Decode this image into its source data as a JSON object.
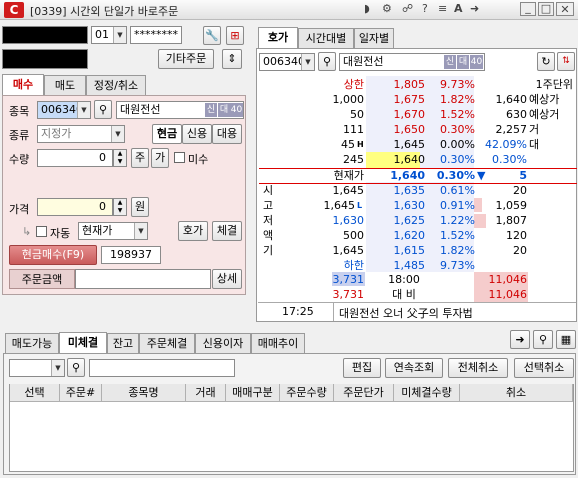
{
  "window": {
    "logo": "C",
    "title": "[0339] 시간외 단일가 바로주문",
    "tb_icons": [
      "headset-icon",
      "gear-icon",
      "link-icon",
      "help-icon",
      "menu-icon",
      "font-icon",
      "sticky-icon",
      "minimize-icon",
      "restore-icon",
      "close-icon"
    ]
  },
  "account": {
    "number": "",
    "suffix": "01",
    "password": "********",
    "name": ""
  },
  "other_order_label": "기타주문",
  "order_tabs": [
    "매수",
    "매도",
    "정정/취소"
  ],
  "order_form": {
    "code_label": "종목",
    "code": "006340",
    "stock_name": "대원전선",
    "badge_credit": "신",
    "badge_rate": "대",
    "badge_margin": "40",
    "type_label": "종류",
    "type_value": "지정가",
    "cash_label": "현금",
    "credit_label": "신용",
    "loan_label": "대용",
    "qty_label": "수량",
    "qty_value": "0",
    "qty_unit": "주",
    "price_short": "가",
    "unfilled_label": "미수",
    "price_label": "가격",
    "price_value": "0",
    "price_unit": "원",
    "auto_label": "자동",
    "auto_mode": "현재가",
    "quote_btn": "호가",
    "fill_btn": "체결",
    "buy_btn": "현금매수(F9)",
    "buy_max": "198937",
    "amount_label": "주문금액",
    "detail_btn": "상세"
  },
  "quote_tabs": [
    "호가",
    "시간대별",
    "일자별"
  ],
  "quote": {
    "code": "006340",
    "stock_name": "대원전선",
    "badge_credit": "신",
    "badge_rate": "대",
    "badge_margin": "40",
    "upper_label": "상한",
    "upper_price": "1,805",
    "upper_pct": "9.73%",
    "unit": "1주단위",
    "ask_rows": [
      {
        "qty": "1,000",
        "price": "1,675",
        "pct": "1.82%",
        "r": "1,640",
        "rl": "예상가"
      },
      {
        "qty": "50",
        "price": "1,670",
        "pct": "1.52%",
        "r": "630",
        "rl": "예상거"
      },
      {
        "qty": "111",
        "price": "1,650",
        "pct": "0.30%",
        "r": "2,257",
        "rl": "거"
      },
      {
        "qty": "45",
        "price": "1,645",
        "pct": "0.00%",
        "r": "42.09%",
        "rl": "대",
        "mark": "H"
      },
      {
        "qty": "245",
        "price": "1,640",
        "pct": "0.30%",
        "r": "0.30%",
        "rl": ""
      }
    ],
    "cur_label": "현재가",
    "cur_price": "1,640",
    "cur_pct": "0.30%",
    "cur_arrow": "▼",
    "cur_change": "5",
    "bid_rows": [
      {
        "label": "시",
        "lv": "1,645",
        "price": "1,635",
        "pct": "0.61%",
        "r": "20"
      },
      {
        "label": "고",
        "lv": "1,645",
        "price": "1,630",
        "pct": "0.91%",
        "r": "1,059",
        "mark": "L"
      },
      {
        "label": "저",
        "lv": "1,630",
        "price": "1,625",
        "pct": "1.22%",
        "r": "1,807"
      },
      {
        "label": "액",
        "lv": "500",
        "price": "1,620",
        "pct": "1.52%",
        "r": "120"
      },
      {
        "label": "기",
        "lv": "1,645",
        "price": "1,615",
        "pct": "1.82%",
        "r": "20"
      }
    ],
    "lower_label": "하한",
    "lower_price": "1,485",
    "lower_pct": "9.73%",
    "total_ask": "3,731",
    "time_close": "18:00",
    "total_bid": "11,046",
    "total_ask2": "3,731",
    "diff_label": "대 비",
    "total_bid2": "11,046",
    "news_time": "17:25",
    "news_text": "대원전선 오너 父子의 투자법"
  },
  "bottom_tabs": [
    "매도가능",
    "미체결",
    "잔고",
    "주문체결",
    "신용이자",
    "매매추이"
  ],
  "bottom_actions": [
    "편집",
    "연속조회",
    "전체취소",
    "선택취소"
  ],
  "columns": [
    "선택",
    "주문#",
    "종목명",
    "거래",
    "매매구분",
    "주문수량",
    "주문단가",
    "미체결수량",
    "취소"
  ]
}
